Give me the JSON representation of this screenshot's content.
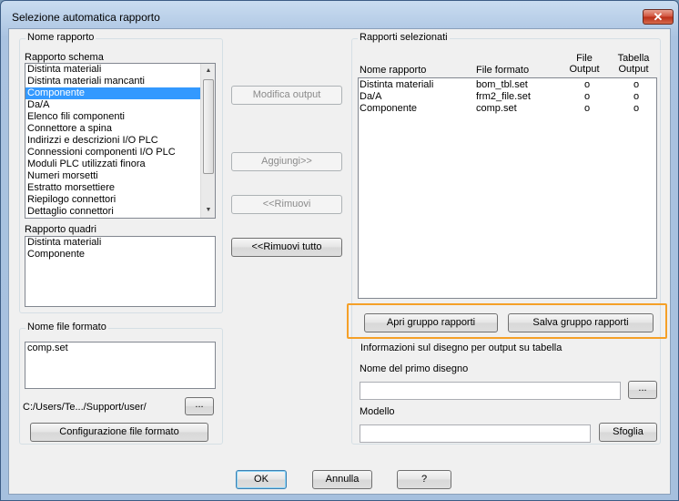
{
  "window": {
    "title": "Selezione automatica rapporto",
    "close_glyph": "✕"
  },
  "left": {
    "group_title": "Nome rapporto",
    "schema_label": "Rapporto schema",
    "schema_items": [
      "Distinta materiali",
      "Distinta materiali mancanti",
      "Componente",
      "Da/A",
      "Elenco fili componenti",
      "Connettore a spina",
      "Indirizzi e descrizioni I/O PLC",
      "Connessioni componenti I/O PLC",
      "Moduli PLC utilizzati finora",
      "Numeri morsetti",
      "Estratto morsettiere",
      "Riepilogo connettori",
      "Dettaglio connettori"
    ],
    "schema_selected": "Componente",
    "quadri_label": "Rapporto quadri",
    "quadri_items": [
      "Distinta materiali",
      "Componente"
    ]
  },
  "format": {
    "group_title": "Nome file formato",
    "items": [
      "comp.set"
    ],
    "path": "C:/Users/Te.../Support/user/",
    "browse_label": "...",
    "config_label": "Configurazione file formato"
  },
  "middle": {
    "modify_label": "Modifica output",
    "add_label": "Aggiungi>>",
    "remove_label": "<<Rimuovi",
    "remove_all_label": "<<Rimuovi tutto"
  },
  "selected": {
    "group_title": "Rapporti selezionati",
    "col_name": "Nome rapporto",
    "col_format": "File formato",
    "col_file_output_1": "File",
    "col_file_output_2": "Output",
    "col_table_output_1": "Tabella",
    "col_table_output_2": "Output",
    "rows": [
      {
        "name": "Distinta materiali",
        "format": "bom_tbl.set",
        "file": "o",
        "table": "o"
      },
      {
        "name": "Da/A",
        "format": "frm2_file.set",
        "file": "o",
        "table": "o"
      },
      {
        "name": "Componente",
        "format": "comp.set",
        "file": "o",
        "table": "o"
      }
    ],
    "open_group_label": "Apri gruppo rapporti",
    "save_group_label": "Salva gruppo rapporti"
  },
  "drawing_info": {
    "group_title": "Informazioni sul disegno per output su tabella",
    "first_drawing_label": "Nome del primo disegno",
    "first_drawing_value": "",
    "browse_label": "...",
    "template_label": "Modello",
    "template_value": "",
    "sfoglia_label": "Sfoglia"
  },
  "footer": {
    "ok_label": "OK",
    "cancel_label": "Annulla",
    "help_label": "?"
  },
  "colors": {
    "selection": "#3399ff",
    "highlight": "#f5a028"
  }
}
